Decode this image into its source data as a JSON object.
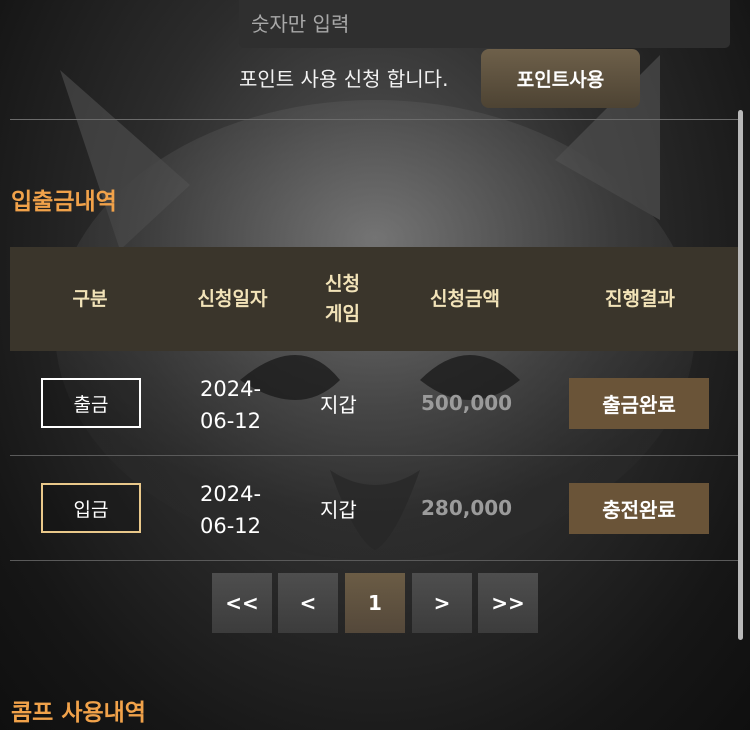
{
  "point_form": {
    "input_placeholder": "숫자만 입력",
    "request_text": "포인트 사용 신청 합니다.",
    "submit_label": "포인트사용"
  },
  "deposit_history": {
    "title": "입출금내역",
    "headers": [
      "구분",
      "신청일자",
      "신청\n게임",
      "신청금액",
      "진행결과"
    ],
    "rows": [
      {
        "type": "출금",
        "date": "2024-\n06-12",
        "game": "지갑",
        "amount": "500,000",
        "status": "출금완료"
      },
      {
        "type": "입금",
        "date": "2024-\n06-12",
        "game": "지갑",
        "amount": "280,000",
        "status": "충전완료"
      }
    ]
  },
  "pagination": {
    "first": "<<",
    "prev": "<",
    "current": "1",
    "next": ">",
    "last": ">>"
  },
  "comp_history": {
    "title": "콤프 사용내역"
  },
  "colors": {
    "accent_orange": "#f1a24a",
    "header_bg": "#3a352b",
    "header_text": "#f2e3b8",
    "status_bg": "#6a5438",
    "button_brown": "#5e5140"
  }
}
